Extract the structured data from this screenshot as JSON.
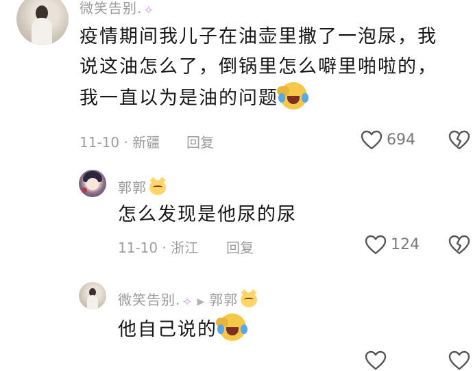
{
  "comments": [
    {
      "username": "微笑告别.",
      "content_line1": "疫情期间我儿子在油壶里撒了一泡尿，我",
      "content_line2": "说这油怎么了，倒锅里怎么噼里啪啦的，",
      "content_line3": "我一直以为是油的问题",
      "date": "11-10",
      "dot": "·",
      "location": "新疆",
      "reply_label": "回复",
      "like_count": "694"
    },
    {
      "username": "郭郭",
      "content": "怎么发现是他尿的尿",
      "date": "11-10",
      "dot": "·",
      "location": "浙江",
      "reply_label": "回复",
      "like_count": "124"
    },
    {
      "username": "微笑告别.",
      "arrow": "▶",
      "reply_to": "郭郭",
      "content": "他自己说的"
    }
  ],
  "icons": {
    "like": "heart-outline-icon",
    "dislike": "broken-heart-icon",
    "laugh": "rofl-emoji",
    "cat": "grinning-cat-emoji",
    "sparkle": "sparkle-emoji"
  },
  "colors": {
    "text": "#161616",
    "meta": "#9c9c9c",
    "icon": "#555555"
  }
}
